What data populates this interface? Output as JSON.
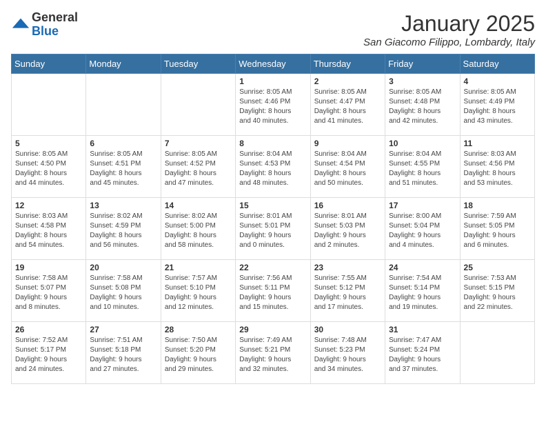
{
  "logo": {
    "general": "General",
    "blue": "Blue"
  },
  "title": "January 2025",
  "location": "San Giacomo Filippo, Lombardy, Italy",
  "headers": [
    "Sunday",
    "Monday",
    "Tuesday",
    "Wednesday",
    "Thursday",
    "Friday",
    "Saturday"
  ],
  "weeks": [
    [
      {
        "day": "",
        "info": ""
      },
      {
        "day": "",
        "info": ""
      },
      {
        "day": "",
        "info": ""
      },
      {
        "day": "1",
        "info": "Sunrise: 8:05 AM\nSunset: 4:46 PM\nDaylight: 8 hours\nand 40 minutes."
      },
      {
        "day": "2",
        "info": "Sunrise: 8:05 AM\nSunset: 4:47 PM\nDaylight: 8 hours\nand 41 minutes."
      },
      {
        "day": "3",
        "info": "Sunrise: 8:05 AM\nSunset: 4:48 PM\nDaylight: 8 hours\nand 42 minutes."
      },
      {
        "day": "4",
        "info": "Sunrise: 8:05 AM\nSunset: 4:49 PM\nDaylight: 8 hours\nand 43 minutes."
      }
    ],
    [
      {
        "day": "5",
        "info": "Sunrise: 8:05 AM\nSunset: 4:50 PM\nDaylight: 8 hours\nand 44 minutes."
      },
      {
        "day": "6",
        "info": "Sunrise: 8:05 AM\nSunset: 4:51 PM\nDaylight: 8 hours\nand 45 minutes."
      },
      {
        "day": "7",
        "info": "Sunrise: 8:05 AM\nSunset: 4:52 PM\nDaylight: 8 hours\nand 47 minutes."
      },
      {
        "day": "8",
        "info": "Sunrise: 8:04 AM\nSunset: 4:53 PM\nDaylight: 8 hours\nand 48 minutes."
      },
      {
        "day": "9",
        "info": "Sunrise: 8:04 AM\nSunset: 4:54 PM\nDaylight: 8 hours\nand 50 minutes."
      },
      {
        "day": "10",
        "info": "Sunrise: 8:04 AM\nSunset: 4:55 PM\nDaylight: 8 hours\nand 51 minutes."
      },
      {
        "day": "11",
        "info": "Sunrise: 8:03 AM\nSunset: 4:56 PM\nDaylight: 8 hours\nand 53 minutes."
      }
    ],
    [
      {
        "day": "12",
        "info": "Sunrise: 8:03 AM\nSunset: 4:58 PM\nDaylight: 8 hours\nand 54 minutes."
      },
      {
        "day": "13",
        "info": "Sunrise: 8:02 AM\nSunset: 4:59 PM\nDaylight: 8 hours\nand 56 minutes."
      },
      {
        "day": "14",
        "info": "Sunrise: 8:02 AM\nSunset: 5:00 PM\nDaylight: 8 hours\nand 58 minutes."
      },
      {
        "day": "15",
        "info": "Sunrise: 8:01 AM\nSunset: 5:01 PM\nDaylight: 9 hours\nand 0 minutes."
      },
      {
        "day": "16",
        "info": "Sunrise: 8:01 AM\nSunset: 5:03 PM\nDaylight: 9 hours\nand 2 minutes."
      },
      {
        "day": "17",
        "info": "Sunrise: 8:00 AM\nSunset: 5:04 PM\nDaylight: 9 hours\nand 4 minutes."
      },
      {
        "day": "18",
        "info": "Sunrise: 7:59 AM\nSunset: 5:05 PM\nDaylight: 9 hours\nand 6 minutes."
      }
    ],
    [
      {
        "day": "19",
        "info": "Sunrise: 7:58 AM\nSunset: 5:07 PM\nDaylight: 9 hours\nand 8 minutes."
      },
      {
        "day": "20",
        "info": "Sunrise: 7:58 AM\nSunset: 5:08 PM\nDaylight: 9 hours\nand 10 minutes."
      },
      {
        "day": "21",
        "info": "Sunrise: 7:57 AM\nSunset: 5:10 PM\nDaylight: 9 hours\nand 12 minutes."
      },
      {
        "day": "22",
        "info": "Sunrise: 7:56 AM\nSunset: 5:11 PM\nDaylight: 9 hours\nand 15 minutes."
      },
      {
        "day": "23",
        "info": "Sunrise: 7:55 AM\nSunset: 5:12 PM\nDaylight: 9 hours\nand 17 minutes."
      },
      {
        "day": "24",
        "info": "Sunrise: 7:54 AM\nSunset: 5:14 PM\nDaylight: 9 hours\nand 19 minutes."
      },
      {
        "day": "25",
        "info": "Sunrise: 7:53 AM\nSunset: 5:15 PM\nDaylight: 9 hours\nand 22 minutes."
      }
    ],
    [
      {
        "day": "26",
        "info": "Sunrise: 7:52 AM\nSunset: 5:17 PM\nDaylight: 9 hours\nand 24 minutes."
      },
      {
        "day": "27",
        "info": "Sunrise: 7:51 AM\nSunset: 5:18 PM\nDaylight: 9 hours\nand 27 minutes."
      },
      {
        "day": "28",
        "info": "Sunrise: 7:50 AM\nSunset: 5:20 PM\nDaylight: 9 hours\nand 29 minutes."
      },
      {
        "day": "29",
        "info": "Sunrise: 7:49 AM\nSunset: 5:21 PM\nDaylight: 9 hours\nand 32 minutes."
      },
      {
        "day": "30",
        "info": "Sunrise: 7:48 AM\nSunset: 5:23 PM\nDaylight: 9 hours\nand 34 minutes."
      },
      {
        "day": "31",
        "info": "Sunrise: 7:47 AM\nSunset: 5:24 PM\nDaylight: 9 hours\nand 37 minutes."
      },
      {
        "day": "",
        "info": ""
      }
    ]
  ]
}
